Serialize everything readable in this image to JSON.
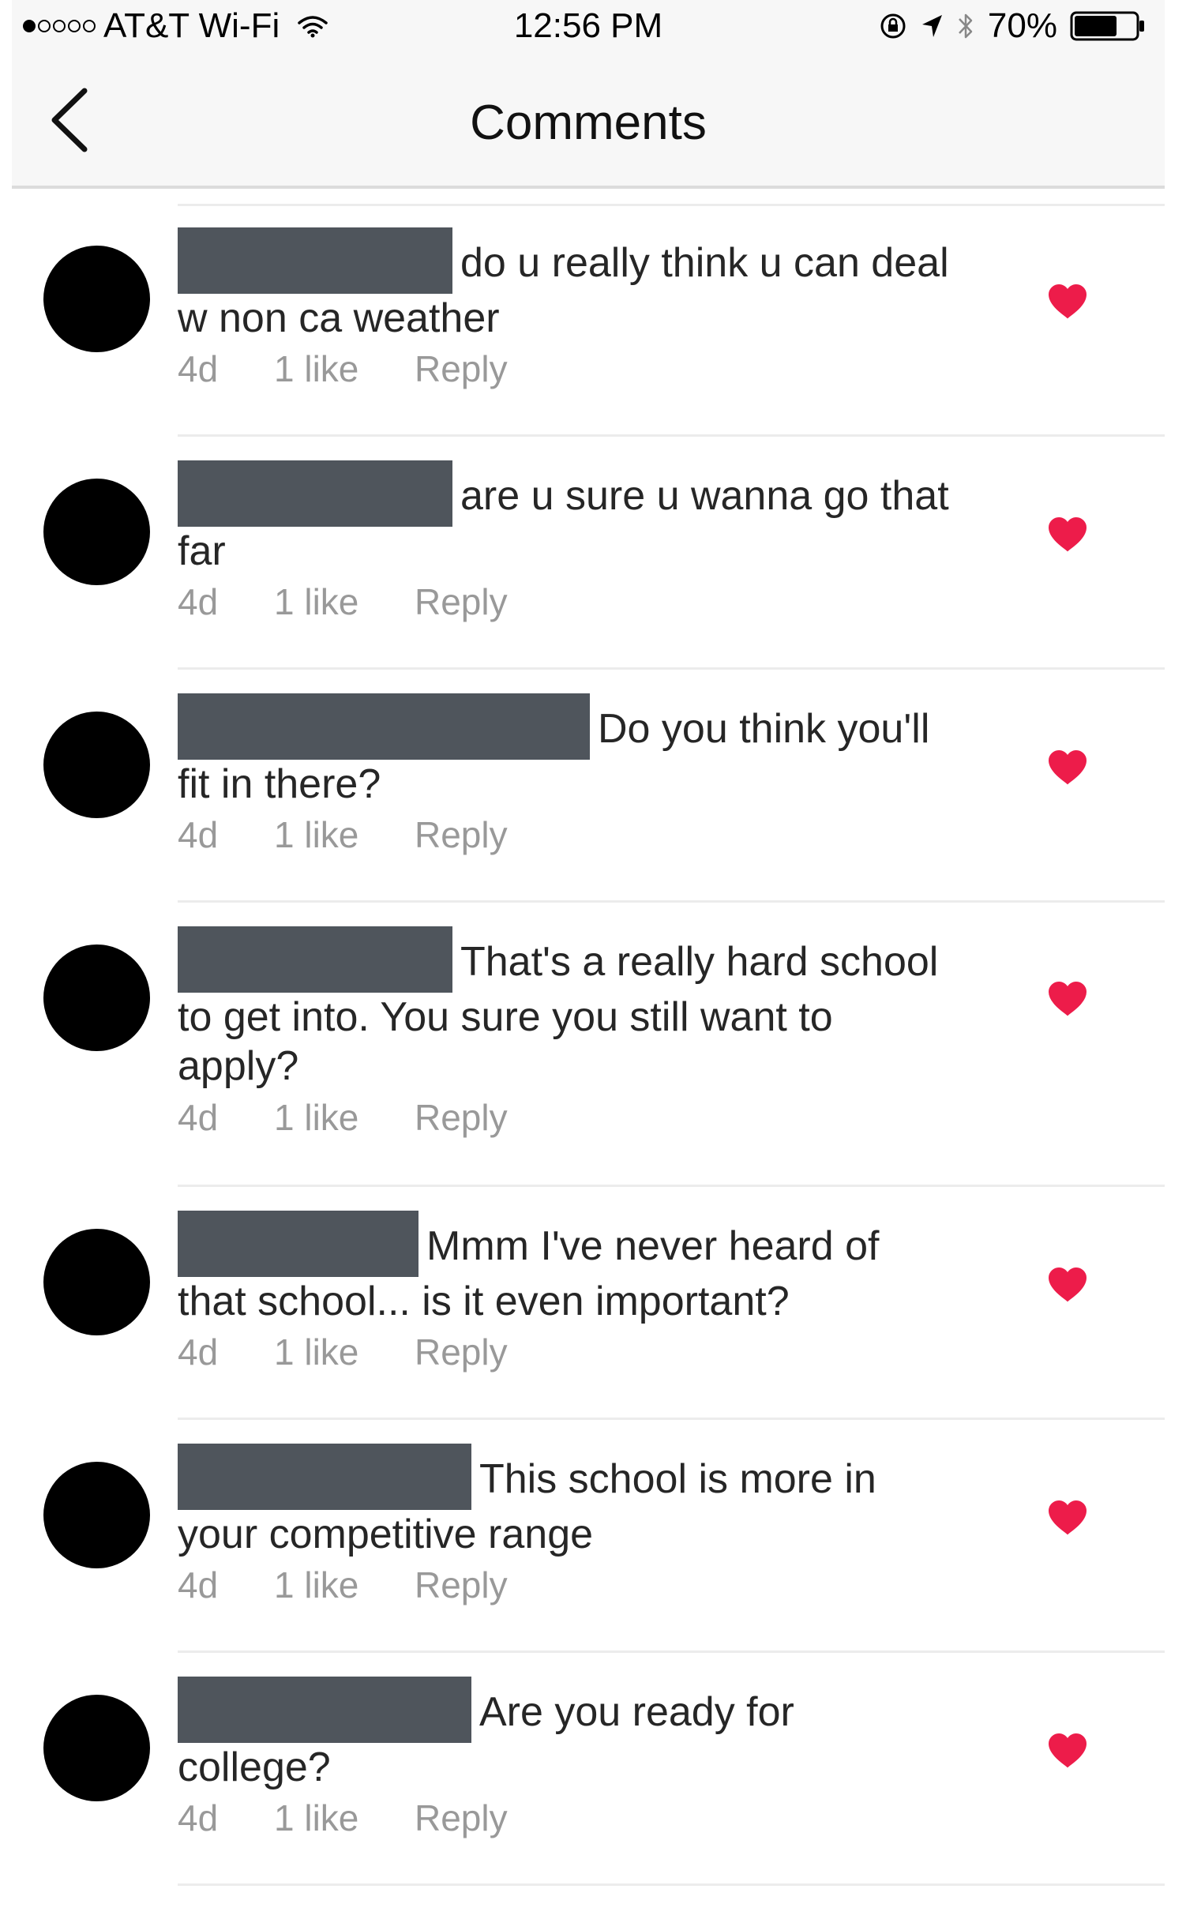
{
  "status_bar": {
    "carrier": "AT&T Wi-Fi",
    "time": "12:56 PM",
    "battery": "70%",
    "signal_filled": 1,
    "signal_total": 5,
    "battery_level": 0.7,
    "icons": [
      "wifi-icon",
      "rotation-lock-icon",
      "location-arrow-icon",
      "bluetooth-icon",
      "battery-icon"
    ]
  },
  "header": {
    "title": "Comments",
    "back_icon": "chevron-left-icon"
  },
  "colors": {
    "heart": "#ed1c4a",
    "meta_text": "#999999",
    "redaction": "#4f555c",
    "avatar": "#000000"
  },
  "comments": [
    {
      "line1": "do u really think u can deal",
      "line2": "w non ca weather",
      "line3": "",
      "age": "4d",
      "likes": "1 like",
      "reply": "Reply",
      "liked": true
    },
    {
      "line1": "are u sure u wanna go that",
      "line2": "far",
      "line3": "",
      "age": "4d",
      "likes": "1 like",
      "reply": "Reply",
      "liked": true
    },
    {
      "line1": "Do you think you'll",
      "line2": "fit in there?",
      "line3": "",
      "age": "4d",
      "likes": "1 like",
      "reply": "Reply",
      "liked": true
    },
    {
      "line1": "That's a really hard school",
      "line2": "to get into. You sure you still want to",
      "line3": "apply?",
      "age": "4d",
      "likes": "1 like",
      "reply": "Reply",
      "liked": true
    },
    {
      "line1": "Mmm I've never heard of",
      "line2": "that school... is it even important?",
      "line3": "",
      "age": "4d",
      "likes": "1 like",
      "reply": "Reply",
      "liked": true
    },
    {
      "line1": "This school is more in",
      "line2": "your competitive range",
      "line3": "",
      "age": "4d",
      "likes": "1 like",
      "reply": "Reply",
      "liked": true
    },
    {
      "line1": "Are you ready for",
      "line2": "college?",
      "line3": "",
      "age": "4d",
      "likes": "1 like",
      "reply": "Reply",
      "liked": true
    }
  ]
}
